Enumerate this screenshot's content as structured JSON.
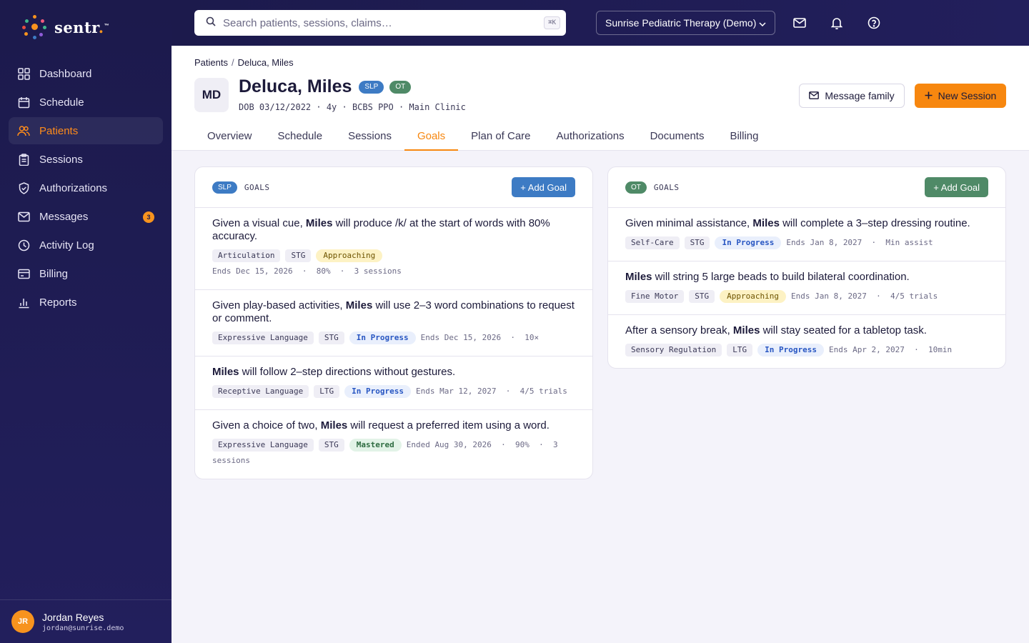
{
  "brand": {
    "name": "sentr",
    "suffix": ".",
    "tm": "™"
  },
  "sidebar": {
    "items": [
      {
        "label": "Dashboard",
        "icon": "grid-icon"
      },
      {
        "label": "Schedule",
        "icon": "calendar-icon"
      },
      {
        "label": "Patients",
        "icon": "users-icon",
        "active": true
      },
      {
        "label": "Sessions",
        "icon": "clipboard-icon"
      },
      {
        "label": "Authorizations",
        "icon": "shield-icon"
      },
      {
        "label": "Messages",
        "icon": "mail-icon",
        "badge": "3"
      },
      {
        "label": "Activity Log",
        "icon": "clock-icon"
      },
      {
        "label": "Billing",
        "icon": "card-icon"
      },
      {
        "label": "Reports",
        "icon": "bar-chart-icon"
      }
    ],
    "user": {
      "initials": "JR",
      "name": "Jordan Reyes",
      "email": "jordan@sunrise.demo"
    }
  },
  "topbar": {
    "search_placeholder": "Search patients, sessions, claims…",
    "shortcut": "⌘K",
    "clinic": "Sunrise Pediatric Therapy (Demo)"
  },
  "breadcrumb": {
    "parent": "Patients",
    "sep": "/",
    "current": "Deluca, Miles"
  },
  "patient": {
    "initials": "MD",
    "name": "Deluca, Miles",
    "disciplines": [
      "SLP",
      "OT"
    ],
    "meta": "DOB 03/12/2022 · 4y · BCBS PPO · Main Clinic"
  },
  "actions": {
    "message": "Message family",
    "new_session": "New Session"
  },
  "tabs": [
    "Overview",
    "Schedule",
    "Sessions",
    "Goals",
    "Plan of Care",
    "Authorizations",
    "Documents",
    "Billing"
  ],
  "active_tab": "Goals",
  "slp_card": {
    "discipline": "SLP",
    "heading": "GOALS",
    "add": "+ Add Goal",
    "goals": [
      {
        "pre": "Given a visual cue, ",
        "name": "Miles",
        "post": " will produce /k/ at the start of words with 80% accuracy.",
        "domain": "Articulation",
        "term": "STG",
        "status": "Approaching",
        "meta": "Ends Dec 15, 2026  ·  80%  ·  3 sessions"
      },
      {
        "pre": "Given play-based activities, ",
        "name": "Miles",
        "post": " will use 2–3 word combinations to request or comment.",
        "domain": "Expressive Language",
        "term": "STG",
        "status": "In Progress",
        "meta": "Ends Dec 15, 2026  ·  10×"
      },
      {
        "pre": "",
        "name": "Miles",
        "post": " will follow 2–step directions without gestures.",
        "domain": "Receptive Language",
        "term": "LTG",
        "status": "In Progress",
        "meta": "Ends Mar 12, 2027  ·  4/5 trials"
      },
      {
        "pre": "Given a choice of two, ",
        "name": "Miles",
        "post": " will request a preferred item using a word.",
        "domain": "Expressive Language",
        "term": "STG",
        "status": "Mastered",
        "meta": "Ended Aug 30, 2026  ·  90%  ·  3 sessions"
      }
    ]
  },
  "ot_card": {
    "discipline": "OT",
    "heading": "GOALS",
    "add": "+ Add Goal",
    "goals": [
      {
        "pre": "Given minimal assistance, ",
        "name": "Miles",
        "post": " will complete a 3–step dressing routine.",
        "domain": "Self-Care",
        "term": "STG",
        "status": "In Progress",
        "meta": "Ends Jan 8, 2027  ·  Min assist"
      },
      {
        "pre": "",
        "name": "Miles",
        "post": " will string 5 large beads to build bilateral coordination.",
        "domain": "Fine Motor",
        "term": "STG",
        "status": "Approaching",
        "meta": "Ends Jan 8, 2027  ·  4/5 trials"
      },
      {
        "pre": "After a sensory break, ",
        "name": "Miles",
        "post": " will stay seated for a tabletop task.",
        "domain": "Sensory Regulation",
        "term": "LTG",
        "status": "In Progress",
        "meta": "Ends Apr 2, 2027  ·  10min"
      }
    ]
  },
  "colors": {
    "accent": "#f7870f",
    "slp": "#3d7bc4",
    "ot": "#4f8a67",
    "sidebar": "#1c1a4c"
  }
}
